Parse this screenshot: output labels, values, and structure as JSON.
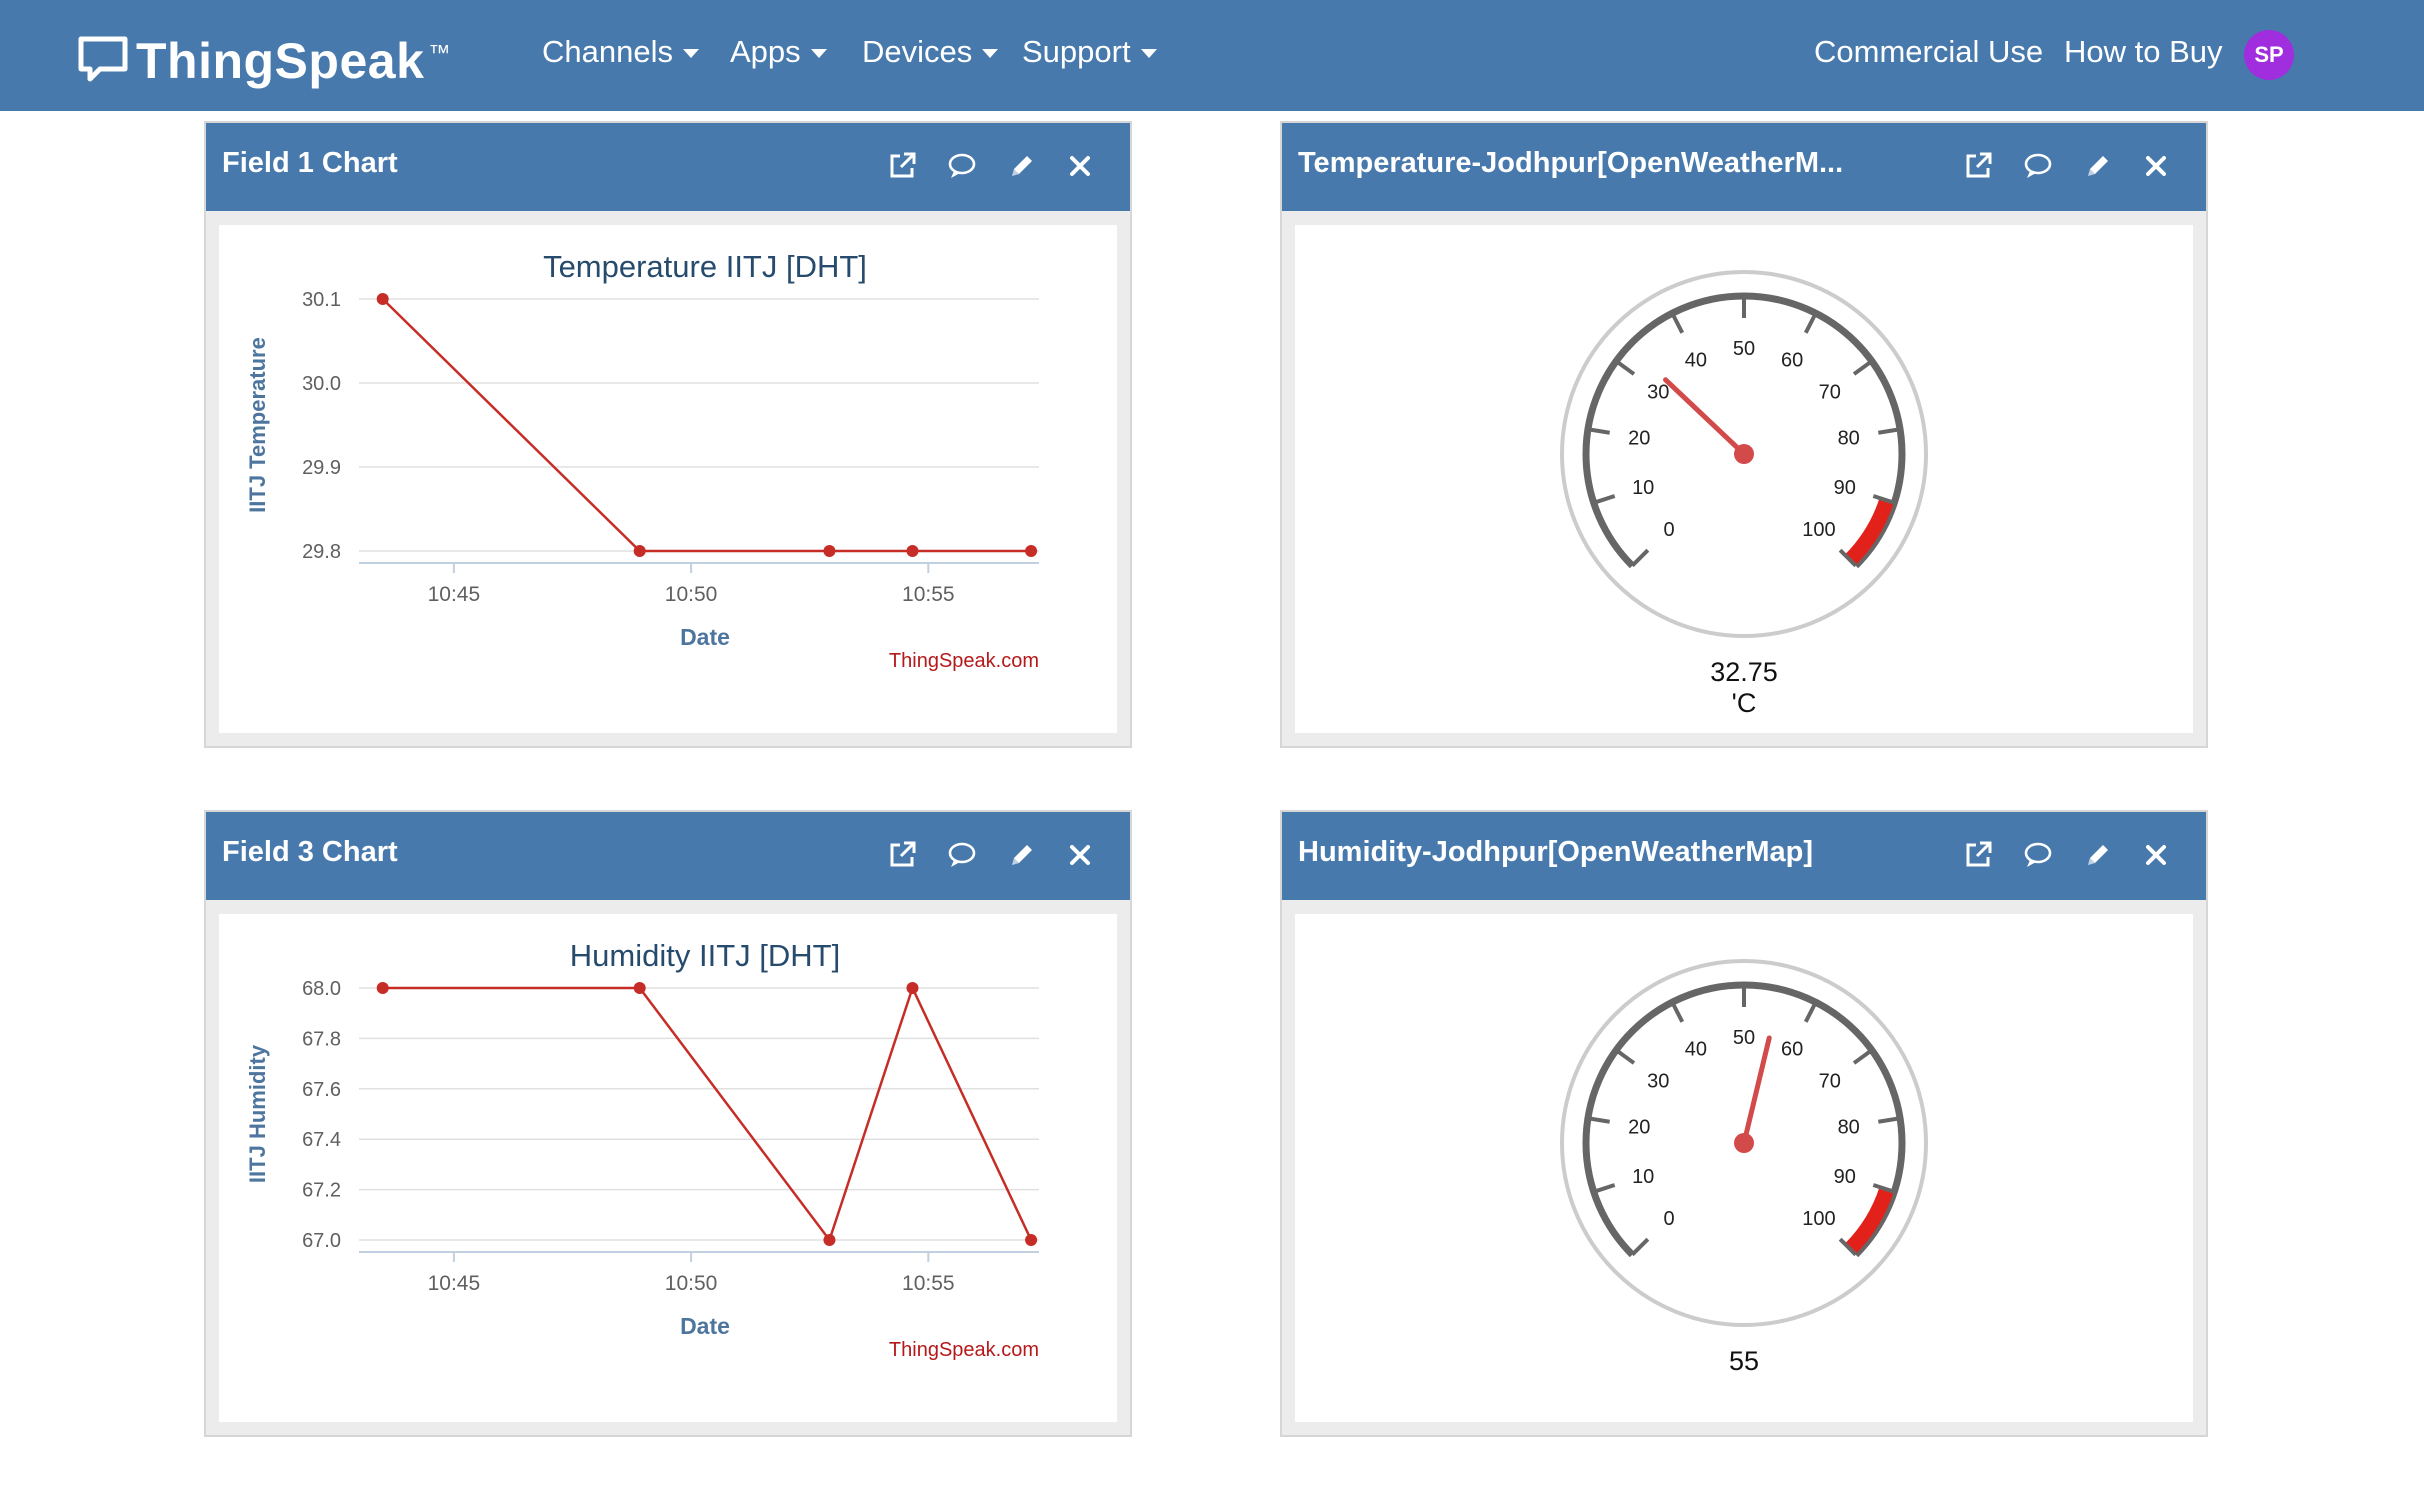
{
  "nav": {
    "brand": "ThingSpeak",
    "trademark": "™",
    "menus": [
      {
        "label": "Channels"
      },
      {
        "label": "Apps"
      },
      {
        "label": "Devices"
      },
      {
        "label": "Support"
      }
    ],
    "commercial_use": "Commercial Use",
    "how_to_buy": "How to Buy",
    "avatar_initials": "SP"
  },
  "panels": {
    "p1": {
      "title": "Field 1 Chart"
    },
    "p2": {
      "title": "Temperature-Jodhpur[OpenWeatherM..."
    },
    "p3": {
      "title": "Field 3 Chart"
    },
    "p4": {
      "title": "Humidity-Jodhpur[OpenWeatherMap]"
    }
  },
  "icons": [
    "external-link-icon",
    "comment-icon",
    "pencil-icon",
    "close-icon"
  ],
  "colors": {
    "nav": "#4779ad",
    "series": "#c62d26",
    "chart_title": "#274b6d",
    "axis_title": "#4d759e",
    "credit": "#b5191a",
    "gauge_needle": "#d24a4a",
    "gauge_band": "#e3211b",
    "avatar": "#a02dde"
  },
  "chart_data": [
    {
      "type": "line",
      "title": "Temperature IITJ [DHT]",
      "xlabel": "Date",
      "ylabel": "IITJ Temperature",
      "credit": "ThingSpeak.com",
      "x": [
        "10:43:30",
        "10:48:55",
        "10:52:55",
        "10:54:40",
        "10:57:10"
      ],
      "y": [
        30.1,
        29.8,
        29.8,
        29.8,
        29.8
      ],
      "x_ticks": [
        "10:45",
        "10:50",
        "10:55"
      ],
      "y_ticks": [
        "29.8",
        "29.9",
        "30.0",
        "30.1"
      ],
      "ylim": [
        29.8,
        30.1
      ],
      "grid": true
    },
    {
      "type": "gauge",
      "value": 32.75,
      "value_label": "32.75",
      "units": "'C",
      "min": 0,
      "max": 100,
      "tick_labels": [
        "0",
        "10",
        "20",
        "30",
        "40",
        "50",
        "60",
        "70",
        "80",
        "90",
        "100"
      ],
      "band": [
        90,
        100
      ]
    },
    {
      "type": "line",
      "title": "Humidity IITJ [DHT]",
      "xlabel": "Date",
      "ylabel": "IITJ Humidity",
      "credit": "ThingSpeak.com",
      "x": [
        "10:43:30",
        "10:48:55",
        "10:52:55",
        "10:54:40",
        "10:57:10"
      ],
      "y": [
        68.0,
        68.0,
        67.0,
        68.0,
        67.0
      ],
      "x_ticks": [
        "10:45",
        "10:50",
        "10:55"
      ],
      "y_ticks": [
        "67.0",
        "67.2",
        "67.4",
        "67.6",
        "67.8",
        "68.0"
      ],
      "ylim": [
        67.0,
        68.0
      ],
      "grid": true
    },
    {
      "type": "gauge",
      "value": 55,
      "value_label": "55",
      "units": "",
      "min": 0,
      "max": 100,
      "tick_labels": [
        "0",
        "10",
        "20",
        "30",
        "40",
        "50",
        "60",
        "70",
        "80",
        "90",
        "100"
      ],
      "band": [
        90,
        100
      ]
    }
  ]
}
